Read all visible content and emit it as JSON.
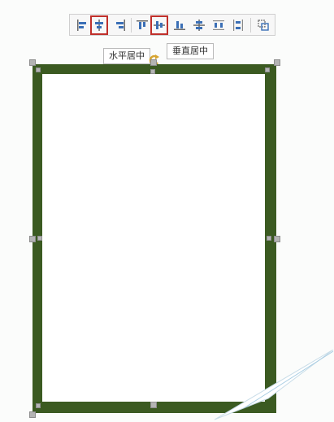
{
  "toolbar": {
    "buttons": [
      {
        "name": "align-left-button",
        "icon": "align-left-icon",
        "highlighted": false
      },
      {
        "name": "align-center-horizontal-button",
        "icon": "align-center-horizontal-icon",
        "highlighted": true
      },
      {
        "name": "align-right-button",
        "icon": "align-right-icon",
        "highlighted": false
      },
      {
        "name": "align-top-button",
        "icon": "align-top-icon",
        "highlighted": false
      },
      {
        "name": "align-center-vertical-button",
        "icon": "align-center-vertical-icon",
        "highlighted": true
      },
      {
        "name": "align-bottom-button",
        "icon": "align-bottom-icon",
        "highlighted": false
      },
      {
        "name": "distribute-center-button",
        "icon": "distribute-icon",
        "highlighted": false
      },
      {
        "name": "distribute-horizontal-button",
        "icon": "distribute-horizontal-icon",
        "highlighted": false
      },
      {
        "name": "distribute-vertical-button",
        "icon": "distribute-vertical-icon",
        "highlighted": false
      },
      {
        "name": "group-button",
        "icon": "group-icon",
        "highlighted": false
      }
    ]
  },
  "tooltips": {
    "horizontal_center": "水平居中",
    "vertical_center": "垂直居中"
  },
  "colors": {
    "frame": "#3b5a21",
    "highlight": "#c0302b",
    "icon": "#3b6fb6",
    "rotate_handle": "#d7a531"
  }
}
